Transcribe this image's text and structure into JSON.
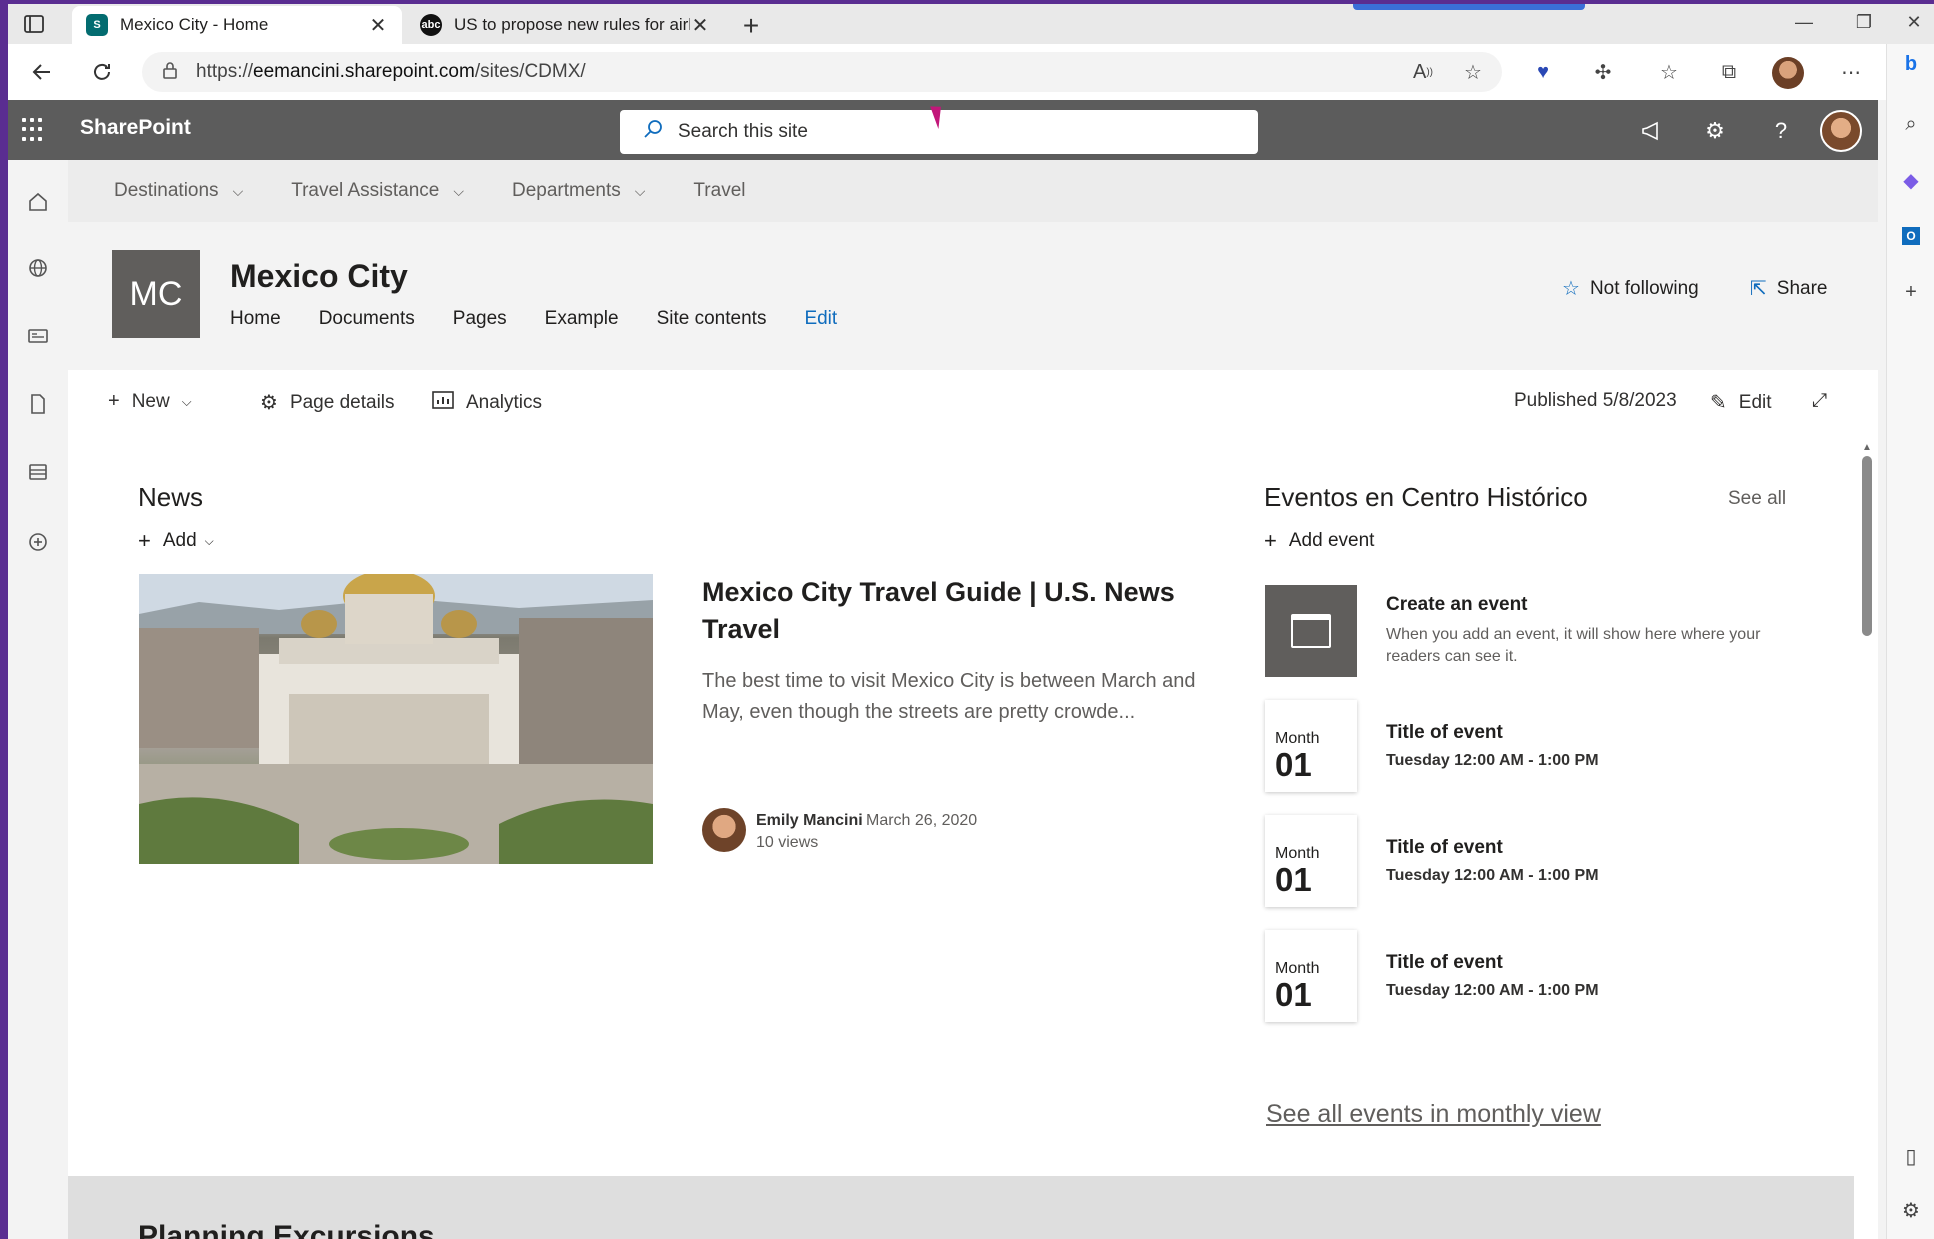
{
  "browser": {
    "tabs": [
      {
        "title": "Mexico City - Home",
        "favicon": "sharepoint-icon",
        "active": true
      },
      {
        "title": "US to propose new rules for airlir",
        "favicon": "abc-news-icon",
        "active": false
      }
    ],
    "favicon_text": {
      "sp": "S",
      "abc": "abc"
    },
    "new_tab_glyph": "+",
    "close_glyph": "✕",
    "url_scheme": "https://",
    "url_host": "eemancini.sharepoint.com",
    "url_path": "/sites/CDMX/"
  },
  "suite": {
    "brand": "SharePoint",
    "search_placeholder": "Search this site"
  },
  "hubnav": {
    "items": [
      {
        "label": "Destinations",
        "has_dropdown": true
      },
      {
        "label": "Travel Assistance",
        "has_dropdown": true
      },
      {
        "label": "Departments",
        "has_dropdown": true
      },
      {
        "label": "Travel",
        "has_dropdown": false
      }
    ]
  },
  "site": {
    "logo_initials": "MC",
    "title": "Mexico City",
    "nav": [
      "Home",
      "Documents",
      "Pages",
      "Example",
      "Site contents"
    ],
    "nav_edit": "Edit",
    "follow_label": "Not following",
    "share_label": "Share"
  },
  "commandbar": {
    "new_label": "New",
    "page_details_label": "Page details",
    "analytics_label": "Analytics",
    "published": "Published 5/8/2023",
    "edit_label": "Edit"
  },
  "news": {
    "section_title": "News",
    "add_label": "Add",
    "article": {
      "title": "Mexico City Travel Guide | U.S. News Travel",
      "excerpt": "The best time to visit Mexico City is between March and May, even though the streets are pretty crowde...",
      "author": "Emily Mancini",
      "date": "March 26, 2020",
      "views": "10 views"
    }
  },
  "events": {
    "section_title": "Eventos en Centro Histórico",
    "see_all": "See all",
    "add_event": "Add event",
    "create": {
      "title": "Create an event",
      "desc": "When you add an event, it will show here where your readers can see it."
    },
    "items": [
      {
        "month": "Month",
        "day": "01",
        "title": "Title of event",
        "time": "Tuesday 12:00 AM - 1:00 PM"
      },
      {
        "month": "Month",
        "day": "01",
        "title": "Title of event",
        "time": "Tuesday 12:00 AM - 1:00 PM"
      },
      {
        "month": "Month",
        "day": "01",
        "title": "Title of event",
        "time": "Tuesday 12:00 AM - 1:00 PM"
      }
    ],
    "monthly_link": "See all events in monthly view"
  },
  "bottom": {
    "section_title": "Planning Excursions"
  },
  "colors": {
    "suite_bar": "#5c5c5c",
    "accent": "#0f6cbd",
    "desktop_bg": "#5a2d91"
  }
}
